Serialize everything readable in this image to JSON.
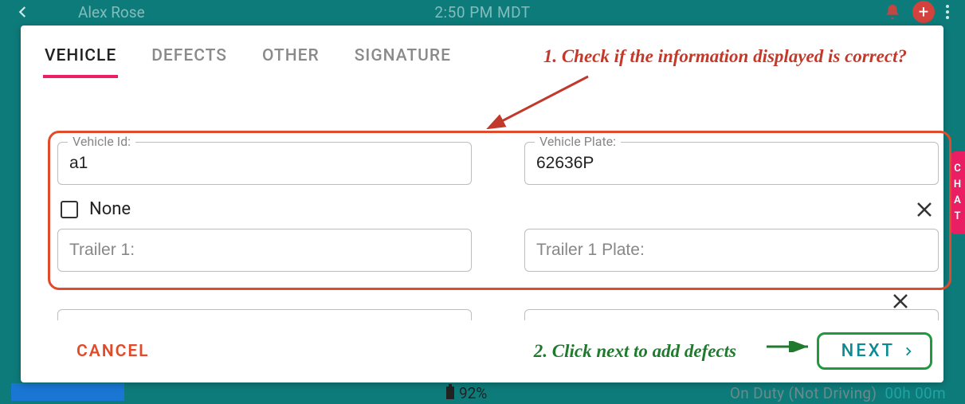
{
  "bg": {
    "name": "Alex Rose",
    "time": "2:50 PM MDT",
    "battery": "92%",
    "status_label": "On Duty (Not Driving)",
    "status_time": "00h  00m",
    "side_pill": [
      "C",
      "H",
      "A",
      "T"
    ]
  },
  "tabs": [
    {
      "key": "vehicle",
      "label": "VEHICLE",
      "active": true
    },
    {
      "key": "defects",
      "label": "DEFECTS",
      "active": false
    },
    {
      "key": "other",
      "label": "OTHER",
      "active": false
    },
    {
      "key": "signature",
      "label": "SIGNATURE",
      "active": false
    }
  ],
  "annotations": {
    "step1": "1. Check if the information displayed is correct?",
    "step2": "2. Click next to add defects"
  },
  "form": {
    "vehicle_id": {
      "label": "Vehicle Id:",
      "value": "a1"
    },
    "vehicle_plate": {
      "label": "Vehicle Plate:",
      "value": "62636P"
    },
    "none_label": "None",
    "none_checked": false,
    "trailer1": {
      "placeholder": "Trailer 1:"
    },
    "trailer1_plate": {
      "placeholder": "Trailer 1 Plate:"
    }
  },
  "buttons": {
    "cancel": "CANCEL",
    "next": "NEXT"
  },
  "colors": {
    "accent_pink": "#e91e63",
    "teal": "#0e7b7b",
    "red": "#e04c2b",
    "green": "#1f9a3e",
    "next_text": "#0b8b94"
  }
}
